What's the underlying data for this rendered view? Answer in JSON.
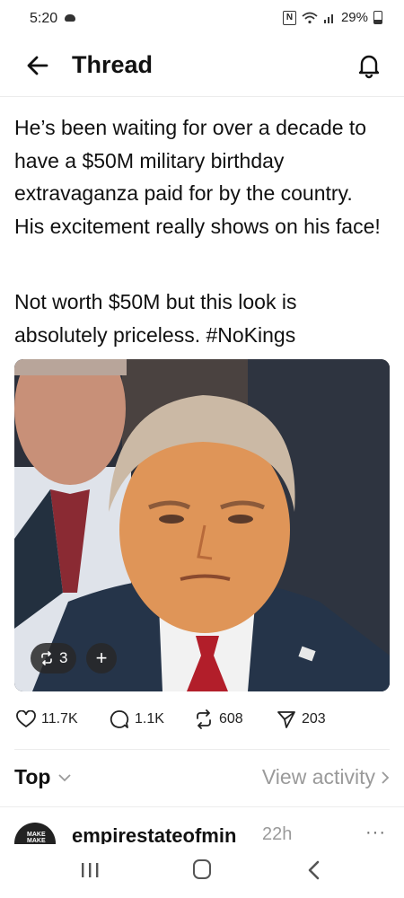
{
  "status_bar": {
    "time": "5:20",
    "battery": "29%"
  },
  "header": {
    "title": "Thread"
  },
  "post": {
    "paragraph1": "He’s been waiting for over a decade to have a $50M military birthday extravaganza paid for by the country. His excitement really shows on his face!",
    "paragraph2": "Not worth $50M but this look is absolutely priceless. #NoKings",
    "image_repost_count": "3",
    "image_add_label": "+"
  },
  "actions": {
    "likes": "11.7K",
    "comments": "1.1K",
    "reposts": "608",
    "shares": "203"
  },
  "sort": {
    "label": "Top",
    "view_activity": "View activity"
  },
  "reply": {
    "avatar_text": "MAKE MAKE",
    "username": "empirestateofmin",
    "time": "22h",
    "more": "···"
  },
  "icons": {
    "back": "arrow-left-icon",
    "bell": "bell-icon",
    "like": "heart-icon",
    "comment": "comment-icon",
    "repost": "repost-icon",
    "share": "send-icon"
  },
  "colors": {
    "text": "#111111",
    "muted": "#9a9a9a",
    "divider": "#ececec"
  }
}
